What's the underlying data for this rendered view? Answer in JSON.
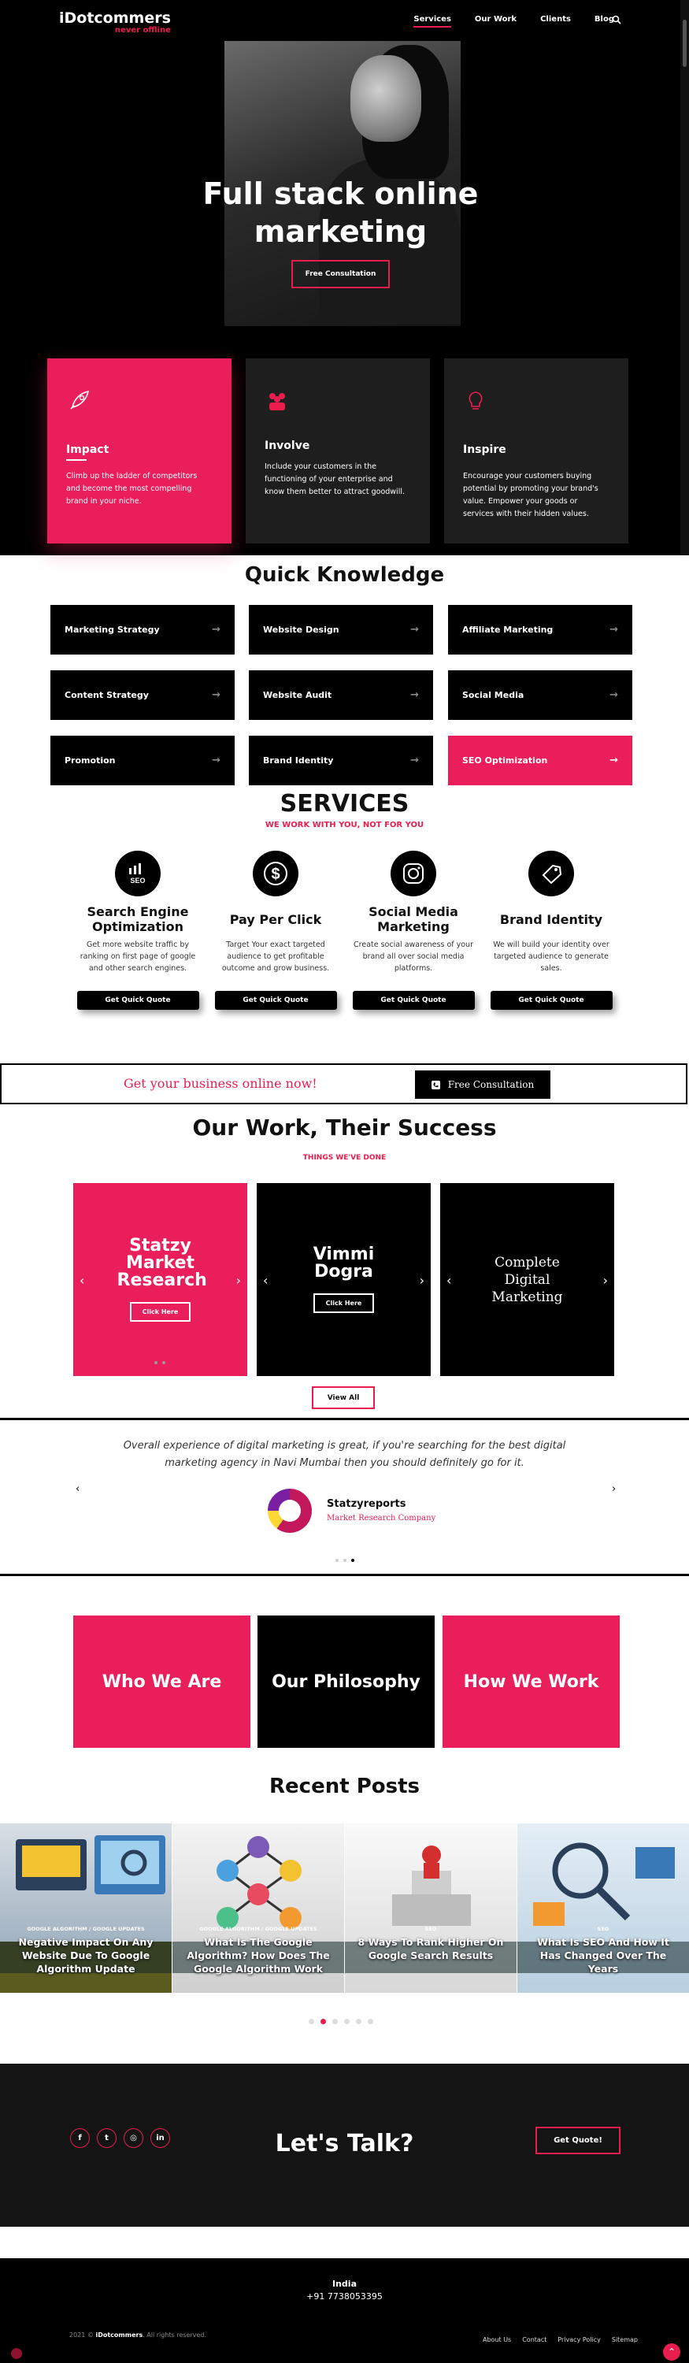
{
  "brand": {
    "name": "iDotcommers",
    "tagline": "never offline",
    "accent": "#e91e4f"
  },
  "nav": {
    "items": [
      "Services",
      "Our Work",
      "Clients",
      "Blog"
    ],
    "active": "Services"
  },
  "hero": {
    "headline": "Full stack online marketing",
    "button": "Free Consultation"
  },
  "features": [
    {
      "title": "Impact",
      "icon": "rocket-icon",
      "text": "Climb up the ladder of competitors and become the most compelling brand in your niche."
    },
    {
      "title": "Involve",
      "icon": "people-icon",
      "text": "Include your customers in the functioning of your enterprise and know them better to attract goodwill."
    },
    {
      "title": "Inspire",
      "icon": "lightbulb-icon",
      "text": "Encourage your customers buying potential by promoting your brand's value. Empower your goods or services with their hidden values."
    }
  ],
  "quick_knowledge": {
    "title": "Quick Knowledge",
    "items": [
      "Marketing Strategy",
      "Website Design",
      "Affiliate Marketing",
      "Content Strategy",
      "Website Audit",
      "Social Media",
      "Promotion",
      "Brand Identity",
      "SEO Optimization"
    ]
  },
  "services": {
    "title": "SERVICES",
    "subtitle": "WE WORK WITH YOU, NOT FOR YOU",
    "button": "Get Quick Quote",
    "items": [
      {
        "title": "Search Engine Optimization",
        "icon": "seo-icon",
        "text": "Get more website traffic by ranking on first page of google and other search engines."
      },
      {
        "title": "Pay Per Click",
        "icon": "dollar-icon",
        "text": "Target Your exact targeted audience to get profitable outcome and grow business."
      },
      {
        "title": "Social Media Marketing",
        "icon": "instagram-icon",
        "text": "Create social awareness of your brand all over social media platforms."
      },
      {
        "title": "Brand Identity",
        "icon": "tag-icon",
        "text": "We will build your identity over targeted audience to generate sales."
      }
    ]
  },
  "cta": {
    "text": "Get your business online now!",
    "button": "Free Consultation"
  },
  "work": {
    "title": "Our Work, Their Success",
    "subtitle": "THINGS WE'VE DONE",
    "button": "View All",
    "items": [
      {
        "title": "Statzy Market Research",
        "button": "Click Here"
      },
      {
        "title": "Vimmi Dogra",
        "button": "Click Here"
      },
      {
        "title": "Complete Digital Marketing",
        "button": ""
      }
    ]
  },
  "testimonial": {
    "quote": "Overall experience of digital marketing is great, if you're searching for the best digital marketing agency in Navi Mumbai then you should definitely go for it.",
    "client": "Statzyreports",
    "client_sub": "Market Research Company"
  },
  "about": {
    "items": [
      "Who We Are",
      "Our Philosophy",
      "How We Work"
    ]
  },
  "posts": {
    "title": "Recent Posts",
    "items": [
      {
        "category": "GOOGLE ALGORITHM / GOOGLE UPDATES",
        "title": "Negative Impact On Any Website Due To Google Algorithm Update"
      },
      {
        "category": "GOOGLE ALGORITHM / GOOGLE UPDATES",
        "title": "What Is The Google Algorithm? How Does The Google Algorithm Work"
      },
      {
        "category": "SEO",
        "title": "8 Ways To Rank Higher On Google Search Results"
      },
      {
        "category": "SEO",
        "title": "What Is SEO And How It Has Changed Over The Years"
      }
    ]
  },
  "talk": {
    "title": "Let's Talk?",
    "button": "Get Quote!"
  },
  "footer": {
    "country": "India",
    "phone": "+91 7738053395",
    "copyright_prefix": "2021 © ",
    "copyright_brand": "iDotcommers",
    "copyright_suffix": ". All rights reserved.",
    "links": [
      "About Us",
      "Contact",
      "Privacy Policy",
      "Sitemap"
    ]
  }
}
